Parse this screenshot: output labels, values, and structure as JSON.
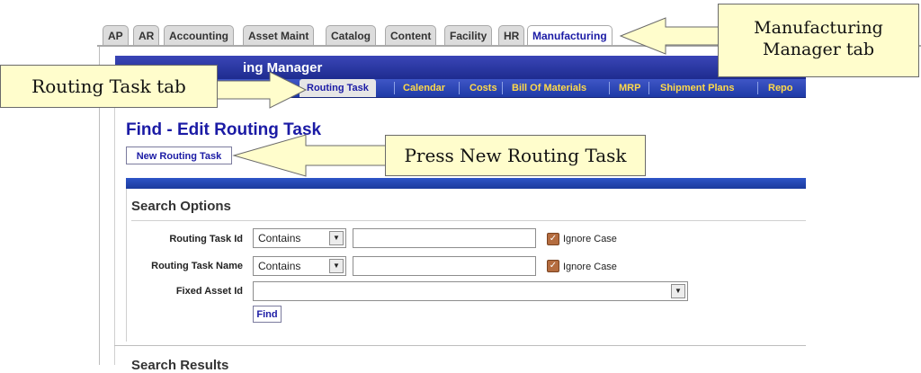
{
  "app_tabs": [
    "AP",
    "AR",
    "Accounting",
    "Asset Maint",
    "Catalog",
    "Content",
    "Facility",
    "HR",
    "Manufacturing"
  ],
  "manager_title": "ing Manager",
  "sub_tabs": [
    "Routing Task",
    "Calendar",
    "Costs",
    "Bill Of Materials",
    "MRP",
    "Shipment Plans",
    "Repo"
  ],
  "page_title": "Find - Edit Routing Task",
  "new_button": "New Routing Task",
  "search_options": {
    "title": "Search Options",
    "routing_task_id": {
      "label": "Routing Task Id",
      "operator": "Contains",
      "value": "",
      "ignore_case": "Ignore Case"
    },
    "routing_task_name": {
      "label": "Routing Task Name",
      "operator": "Contains",
      "value": "",
      "ignore_case": "Ignore Case"
    },
    "fixed_asset_id": {
      "label": "Fixed Asset Id",
      "value": ""
    },
    "find_button": "Find"
  },
  "search_results_title": "Search Results",
  "callouts": {
    "manufacturing_manager": "Manufacturing Manager tab",
    "routing_task": "Routing Task tab",
    "press_new": "Press New Routing Task"
  }
}
